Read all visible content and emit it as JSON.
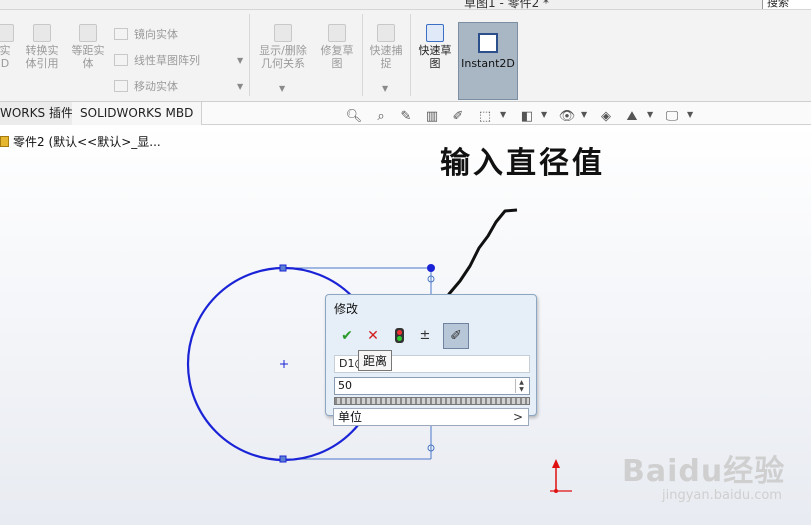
{
  "window": {
    "title": "草图1 - 零件2 *",
    "search_label": "搜索"
  },
  "ribbon": {
    "groups": [
      {
        "label": "实体",
        "lines": [
          "实",
          "D"
        ]
      },
      {
        "label": "转换实体引用",
        "lines": [
          "转换实",
          "体引用"
        ]
      },
      {
        "label": "等距实体",
        "lines": [
          "等距实",
          "体"
        ]
      },
      {
        "label": "显示/删除几何关系",
        "lines": [
          "显示/删除",
          "几何关系"
        ]
      },
      {
        "label": "修复草图",
        "lines": [
          "修复草",
          "图"
        ]
      },
      {
        "label": "快速捕捉",
        "lines": [
          "快速捕",
          "捉"
        ]
      },
      {
        "label": "快速草图",
        "lines": [
          "快速草",
          "图"
        ]
      },
      {
        "label": "Instant2D"
      }
    ],
    "small_items": {
      "mirror": "镜向实体",
      "linear_pattern": "线性草图阵列",
      "move": "移动实体"
    }
  },
  "tabs": [
    "WORKS 插件",
    "SOLIDWORKS MBD"
  ],
  "feature_tree": {
    "part_label": "零件2 (默认<<默认>_显..."
  },
  "annotation": {
    "text": "输入直径值"
  },
  "modify_dialog": {
    "title": "修改",
    "dimension_name": "D1@",
    "value": "50",
    "unit_label": "单位",
    "unit_chevron": ">",
    "tooltip": "距离",
    "icons": [
      "ok-icon",
      "cancel-icon",
      "rebuild-icon",
      "reverse-icon",
      "mark-dimension-icon"
    ]
  },
  "watermark": {
    "brand": "Baidu经验",
    "url": "jingyan.baidu.com"
  },
  "colors": {
    "sketch_blue": "#1a23d6",
    "dim_line": "#4a78c8",
    "origin_red": "#e01010",
    "active_tool": "#a9b7c5"
  }
}
